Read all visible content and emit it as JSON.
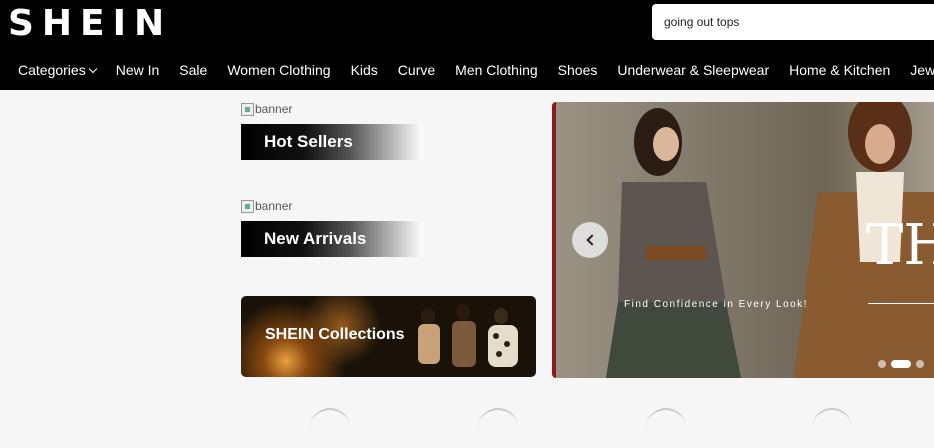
{
  "header": {
    "logo": "SHEIN",
    "search_value": "going out tops"
  },
  "nav": {
    "items": [
      {
        "label": "Categories"
      },
      {
        "label": "New In"
      },
      {
        "label": "Sale"
      },
      {
        "label": "Women Clothing"
      },
      {
        "label": "Kids"
      },
      {
        "label": "Curve"
      },
      {
        "label": "Men Clothing"
      },
      {
        "label": "Shoes"
      },
      {
        "label": "Underwear & Sleepwear"
      },
      {
        "label": "Home & Kitchen"
      },
      {
        "label": "Jewelry"
      }
    ]
  },
  "promos": {
    "broken_alt": "banner",
    "hot_sellers": "Hot Sellers",
    "new_arrivals": "New Arrivals",
    "collections": "SHEIN Collections"
  },
  "hero": {
    "tagline": "Find Confidence in Every Look!",
    "big_text": "TH",
    "slides": 3,
    "active_slide": 2
  },
  "colors": {
    "header_bg": "#000000",
    "page_bg": "#f6f6f6",
    "hero_accent": "#8b1a1a"
  }
}
